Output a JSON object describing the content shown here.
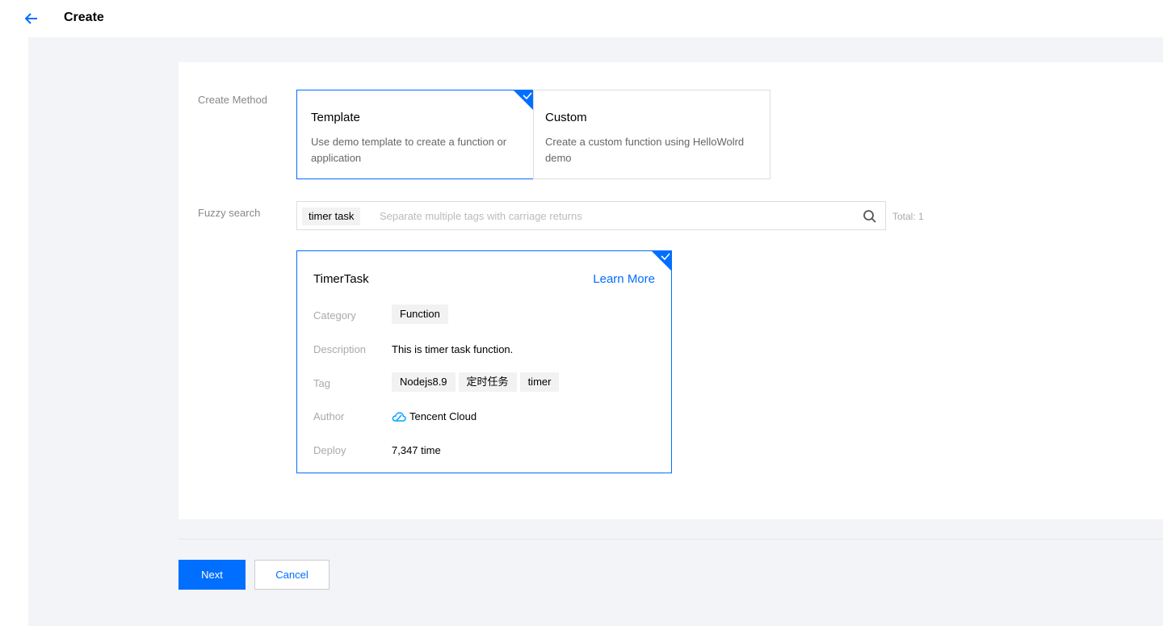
{
  "header": {
    "title": "Create",
    "back_icon": "arrow-left-icon"
  },
  "form": {
    "create_method_label": "Create Method",
    "fuzzy_search_label": "Fuzzy search"
  },
  "methods": [
    {
      "title": "Template",
      "desc": "Use demo template to create a function or application",
      "selected": true
    },
    {
      "title": "Custom",
      "desc": "Create a custom function using HelloWolrd demo",
      "selected": false
    }
  ],
  "search": {
    "tag": "timer task",
    "placeholder": "Separate multiple tags with carriage returns",
    "total": "Total: 1"
  },
  "template_card": {
    "title": "TimerTask",
    "learn_more": "Learn More",
    "category_label": "Category",
    "category": "Function",
    "description_label": "Description",
    "description": "This is timer task function.",
    "tag_label": "Tag",
    "tags": [
      "Nodejs8.9",
      "定时任务",
      "timer"
    ],
    "author_label": "Author",
    "author": "Tencent Cloud",
    "deploy_label": "Deploy",
    "deploy": "7,347 time"
  },
  "footer": {
    "next_label": "Next",
    "cancel_label": "Cancel"
  },
  "colors": {
    "accent": "#006eff",
    "background": "#f3f4f7"
  }
}
